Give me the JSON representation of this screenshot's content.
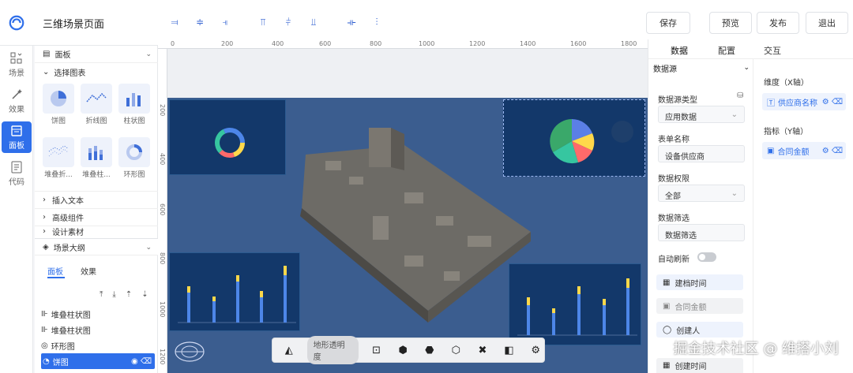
{
  "app": {
    "title": "三维场景页面"
  },
  "header": {
    "buttons": [
      "保存",
      "预览",
      "发布",
      "退出"
    ]
  },
  "rail": [
    {
      "label": "场景",
      "icon": "scene-icon"
    },
    {
      "label": "效果",
      "icon": "effect-icon"
    },
    {
      "label": "面板",
      "icon": "panel-icon",
      "active": true
    },
    {
      "label": "代码",
      "icon": "code-icon"
    }
  ],
  "panel": {
    "header": "面板",
    "select_chart": "选择图表",
    "charts": [
      "饼图",
      "折线图",
      "柱状图",
      "堆叠折...",
      "堆叠柱...",
      "环形图"
    ],
    "sections": [
      "插入文本",
      "高级组件",
      "设计素材"
    ]
  },
  "outline": {
    "title": "场景大纲",
    "tabs": [
      "面板",
      "效果"
    ],
    "items": [
      "堆叠柱状图",
      "堆叠柱状图",
      "环形图",
      "饼图"
    ]
  },
  "ruler": {
    "h": [
      "0",
      "200",
      "400",
      "600",
      "800",
      "1000",
      "1200",
      "1400",
      "1600",
      "1800"
    ],
    "v": [
      "200",
      "400",
      "600",
      "800",
      "1000",
      "1200"
    ]
  },
  "right": {
    "tabs": [
      "数据",
      "配置",
      "交互"
    ],
    "datasource": "数据源",
    "source_type_label": "数据源类型",
    "source_type_value": "应用数据",
    "form_name_label": "表单名称",
    "form_name_value": "设备供应商",
    "permission_label": "数据权限",
    "permission_value": "全部",
    "filter_label": "数据筛选",
    "filter_value": "数据筛选",
    "auto_refresh_label": "自动刷新",
    "dimension_label": "维度（X轴）",
    "dimension_value": "供应商名称",
    "metric_label": "指标（Y轴）",
    "metric_value": "合同金额",
    "fields": [
      "建档时间",
      "合同金额",
      "创建人",
      "创建时间"
    ]
  },
  "toolbar": {
    "opacity_label": "地形透明度"
  },
  "watermark": {
    "text": "掘金技术社区 @ 维搭小刘"
  },
  "colors": {
    "accent": "#2f6fea",
    "stage": "#3b5d8f",
    "panel": "#13386a"
  }
}
